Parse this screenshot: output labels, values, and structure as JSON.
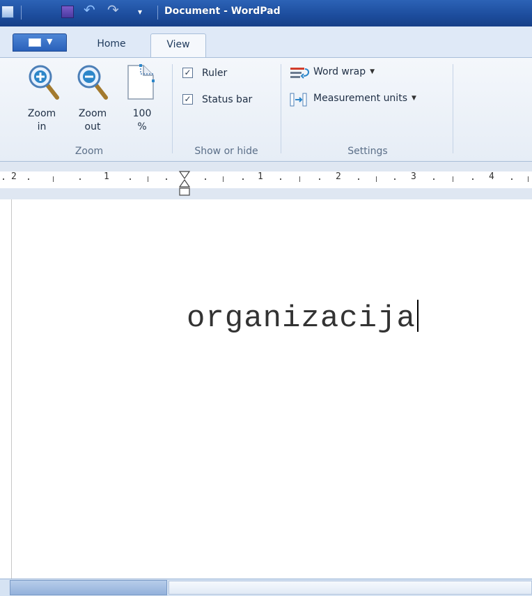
{
  "window": {
    "title": "Document - WordPad"
  },
  "tabs": [
    {
      "label": "Home"
    },
    {
      "label": "View"
    }
  ],
  "ribbon": {
    "zoom": {
      "zoom_in": [
        "Zoom",
        "in"
      ],
      "zoom_out": [
        "Zoom",
        "out"
      ],
      "hundred": [
        "100",
        "%"
      ],
      "group_label": "Zoom"
    },
    "show_hide": {
      "ruler": {
        "label": "Ruler",
        "checked": true
      },
      "status_bar": {
        "label": "Status bar",
        "checked": true
      },
      "group_label": "Show or hide"
    },
    "settings": {
      "word_wrap": "Word wrap",
      "measurement_units": "Measurement units",
      "group_label": "Settings"
    }
  },
  "ruler": {
    "labels": [
      "2",
      "1",
      "1",
      "2",
      "3",
      "4"
    ]
  },
  "document": {
    "text": "organizacija"
  },
  "colors": {
    "titlebar": "#1c4c9c",
    "ribbon": "#e6edf6",
    "accent": "#2a61ba"
  },
  "icons": [
    "app-icon",
    "save-icon",
    "undo-icon",
    "redo-icon",
    "customize-icon",
    "app-menu-icon",
    "zoom-in-icon",
    "zoom-out-icon",
    "page-100-icon",
    "word-wrap-icon",
    "measurement-units-icon",
    "indent-marker-icon"
  ]
}
